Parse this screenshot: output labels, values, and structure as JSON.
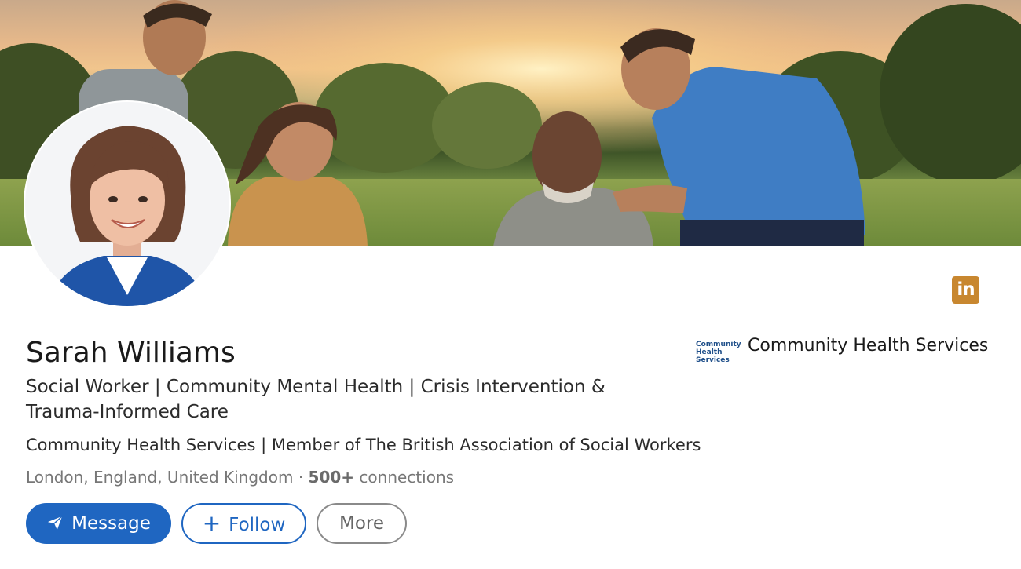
{
  "profile": {
    "name": "Sarah Williams",
    "headline": "Social Worker | Community Mental Health | Crisis Intervention & Trauma-Informed Care",
    "organizations": "Community Health Services | Member of The British Association of Social Workers",
    "location": "London, England, United Kingdom",
    "separator": " · ",
    "connections": "500+",
    "connections_label": " connections"
  },
  "actions": {
    "message_label": "Message",
    "follow_label": "Follow",
    "follow_prefix": "+",
    "more_label": "More"
  },
  "company": {
    "name": "Community Health Services",
    "logo_lines": [
      "Community",
      "Health",
      "Services"
    ]
  },
  "badges": {
    "linkedin_text": "in"
  },
  "colors": {
    "primary": "#1f66c1",
    "linkedin_badge": "#c8872f"
  },
  "icons": {
    "message": "paper-plane-icon",
    "linkedin": "linkedin-icon"
  }
}
